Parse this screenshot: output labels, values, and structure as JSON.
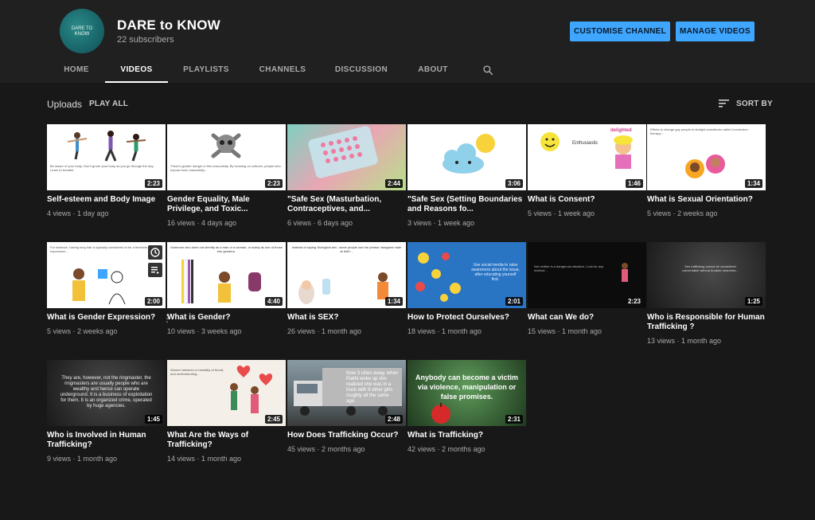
{
  "channel": {
    "name": "DARE to KNOW",
    "subscribers": "22 subscribers",
    "logo_text": "DARE TO KNOW"
  },
  "buttons": {
    "customise": "CUSTOMISE CHANNEL",
    "manage": "MANAGE VIDEOS"
  },
  "tabs": [
    {
      "label": "HOME"
    },
    {
      "label": "VIDEOS"
    },
    {
      "label": "PLAYLISTS"
    },
    {
      "label": "CHANNELS"
    },
    {
      "label": "DISCUSSION"
    },
    {
      "label": "ABOUT"
    }
  ],
  "active_tab": "VIDEOS",
  "section": {
    "title": "Uploads",
    "play_all": "PLAY ALL",
    "sort_label": "SORT BY"
  },
  "videos": [
    {
      "title": "Self-esteem and Body Image",
      "duration": "2:23",
      "views": "4 views",
      "age": "1 day ago"
    },
    {
      "title": "Gender Equality, Male Privilege, and Toxic...",
      "duration": "2:23",
      "views": "16 views",
      "age": "4 days ago"
    },
    {
      "title": "\"Safe Sex (Masturbation, Contraceptives, and...",
      "duration": "2:44",
      "views": "6 views",
      "age": "6 days ago"
    },
    {
      "title": "\"Safe Sex (Setting Boundaries and Reasons fo...",
      "duration": "3:06",
      "views": "3 views",
      "age": "1 week ago"
    },
    {
      "title": "What is Consent?",
      "duration": "1:46",
      "views": "5 views",
      "age": "1 week ago"
    },
    {
      "title": "What is Sexual Orientation?",
      "duration": "1:34",
      "views": "5 views",
      "age": "2 weeks ago"
    },
    {
      "title": "What is Gender Expression?",
      "duration": "2:00",
      "views": "5 views",
      "age": "2 weeks ago"
    },
    {
      "title": "What is Gender?",
      "duration": "4:40",
      "views": "10 views",
      "age": "3 weeks ago"
    },
    {
      "title": "What is SEX?",
      "duration": "1:34",
      "views": "26 views",
      "age": "1 month ago"
    },
    {
      "title": "How to Protect Ourselves?",
      "duration": "2:01",
      "views": "18 views",
      "age": "1 month ago"
    },
    {
      "title": "What can We do?",
      "duration": "2:23",
      "views": "15 views",
      "age": "1 month ago"
    },
    {
      "title": "Who is Responsible for Human Trafficking ?",
      "duration": "1:25",
      "views": "13 views",
      "age": "1 month ago"
    },
    {
      "title": "Who is Involved in Human Trafficking?",
      "duration": "1:45",
      "views": "9 views",
      "age": "1 month ago"
    },
    {
      "title": "What Are the Ways of Trafficking?",
      "duration": "2:45",
      "views": "14 views",
      "age": "1 month ago"
    },
    {
      "title": "How Does Trafficking Occur?",
      "duration": "2:48",
      "views": "45 views",
      "age": "2 months ago"
    },
    {
      "title": "What is Trafficking?",
      "duration": "2:31",
      "views": "42 views",
      "age": "2 months ago"
    }
  ],
  "thumb_text": {
    "t1": "Be aware of your body. Don't ignore your body as you go through the day. Learn to breathe.",
    "t2": "There's gender danger in this masculinity. By focusing on cultures, people who expose toxic masculinity...",
    "t5": "Enthusiastic",
    "t5b": "delighted",
    "t6": "Efforts to change gay people to straight sometimes called 'conversion therapy'...",
    "t7": "For instance, having long hair is typically considered to be a feminine expression...",
    "t8": "Someone who does not identify as a man or a woman, or solely as one of those two genders.",
    "t9": "Instead of saying 'biological sex', some people use the phrase 'assigned male at birth'...",
    "t10": "Use social media to raise awareness about the issue, after educating yourself first.",
    "t11": "Not neither is a dangerous situation. Look for any method...",
    "t12": "Sex trafficking cannot be considered preventable without broader searches...",
    "t13": "They are, however, not the ringmaster, the ringmasters are usually people who are wealthy and hence can operate underground. It is a business of exploitation for them. It is an organized crime, operated by huge agencies.",
    "t14": "Women between a mentality of threat, and understanding...",
    "t15": "Now 3 cities away, when Rakhi woke up she realized she was in a truck with 9 other girls roughly all the same age.",
    "t16": "Anybody can become a victim via violence, manipulation or false promises."
  },
  "icons": {
    "search": "search-icon",
    "sort": "sort-icon",
    "clock": "watch-later-icon",
    "queue": "add-to-queue-icon",
    "more": "more-vert-icon"
  },
  "colors": {
    "accent": "#3ea6ff",
    "background": "#181818",
    "header": "#202020"
  }
}
